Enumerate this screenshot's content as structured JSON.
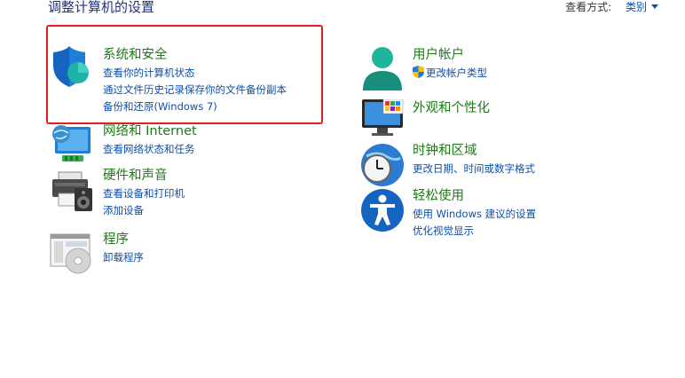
{
  "page": {
    "heading": "调整计算机的设置",
    "view_by_label": "查看方式:",
    "view_by_value": "类别"
  },
  "left_column": [
    {
      "title": "系统和安全",
      "icon": "shield-icon",
      "links": [
        "查看你的计算机状态",
        "通过文件历史记录保存你的文件备份副本",
        "备份和还原(Windows 7)"
      ]
    },
    {
      "title": "网络和 Internet",
      "icon": "network-globe-icon",
      "links": [
        "查看网络状态和任务"
      ]
    },
    {
      "title": "硬件和声音",
      "icon": "printer-speaker-icon",
      "links": [
        "查看设备和打印机",
        "添加设备"
      ]
    },
    {
      "title": "程序",
      "icon": "programs-disc-icon",
      "links": [
        "卸载程序"
      ]
    }
  ],
  "right_column": [
    {
      "title": "用户帐户",
      "icon": "user-icon",
      "links": [
        "更改帐户类型"
      ]
    },
    {
      "title": "外观和个性化",
      "icon": "monitor-palette-icon",
      "links": []
    },
    {
      "title": "时钟和区域",
      "icon": "clock-globe-icon",
      "links": [
        "更改日期、时间或数字格式"
      ]
    },
    {
      "title": "轻松使用",
      "icon": "accessibility-icon",
      "links": [
        "使用 Windows 建议的设置",
        "优化视觉显示"
      ]
    }
  ],
  "colors": {
    "title_green": "#1d7a17",
    "link_blue": "#0f4fa8",
    "heading_blue": "#1e3287",
    "highlight_red": "#e02020"
  }
}
